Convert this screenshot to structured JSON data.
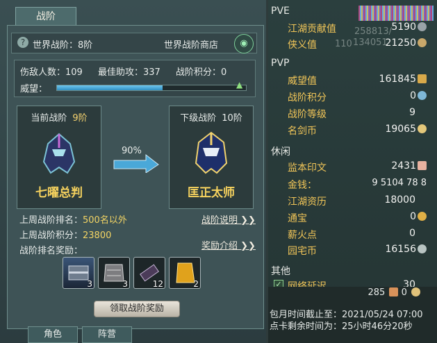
{
  "left": {
    "tab": "战阶",
    "world_rank_label": "世界战阶：8阶",
    "world_shop": "世界战阶商店",
    "stats": {
      "kills": "伤敌人数：109",
      "assist": "最佳助攻：337",
      "points": "战阶积分：0",
      "prestige_label": "威望：",
      "prestige_fraction": 0.56
    },
    "current": {
      "title": "当前战阶",
      "level": "9阶",
      "name": "七曜总判"
    },
    "next": {
      "title": "下级战阶",
      "level": "10阶",
      "name": "匡正太师"
    },
    "progress_pct": "90%",
    "last_week_rank_label": "上周战阶排名：",
    "last_week_rank_value": "500名以外",
    "last_week_points_label": "上周战阶积分：",
    "last_week_points_value": "23800",
    "reward_label": "战阶排名奖励：",
    "explain_link": "战阶说明",
    "reward_link": "奖励介绍",
    "rewards": [
      {
        "icon": "chest-icon",
        "count": "3"
      },
      {
        "icon": "armor-icon",
        "count": "3"
      },
      {
        "icon": "scroll-icon",
        "count": "12"
      },
      {
        "icon": "gold-bar-icon",
        "count": "2"
      }
    ],
    "claim_button": "领取战阶奖励",
    "bottom_tabs": [
      "角色",
      "阵营"
    ]
  },
  "right": {
    "pve": {
      "title": "PVE",
      "rows": [
        {
          "label": "江湖贡献值",
          "value": "5190"
        },
        {
          "label": "侠义值",
          "value": "21250"
        }
      ]
    },
    "pvp": {
      "title": "PVP",
      "rows": [
        {
          "label": "威望值",
          "value": "161845"
        },
        {
          "label": "战阶积分",
          "value": "0"
        },
        {
          "label": "战阶等级",
          "value": "9"
        },
        {
          "label": "名剑币",
          "value": "19065"
        }
      ]
    },
    "leisure": {
      "title": "休闲",
      "rows": [
        {
          "label": "监本印文",
          "value": "2431"
        },
        {
          "label": "金钱：",
          "value": "9 5104 78 8"
        },
        {
          "label": "江湖资历",
          "value": "18000"
        },
        {
          "label": "通宝",
          "value": "0"
        },
        {
          "label": "薪火点",
          "value": "0"
        },
        {
          "label": "园宅币",
          "value": "16156"
        }
      ]
    },
    "other": {
      "title": "其他",
      "rows": [
        {
          "label": "网络延迟",
          "value": "30"
        }
      ]
    },
    "ghost_numbers": [
      "258813/",
      "134051",
      "110"
    ],
    "currency_bar": {
      "a": "285",
      "b": "0"
    },
    "footer_line1": "包月时间截止至：2021/05/24 07:00",
    "footer_line2": "点卡剩余时间为：25小时46分20秒"
  },
  "colors": {
    "gold": "#f4d564",
    "label": "#f2c658",
    "accent_blue": "#4aa8d8"
  }
}
